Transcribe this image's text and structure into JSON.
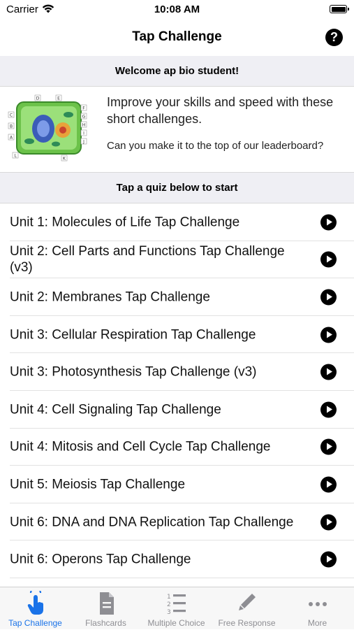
{
  "status_bar": {
    "carrier": "Carrier",
    "time": "10:08 AM"
  },
  "nav": {
    "title": "Tap Challenge",
    "help_symbol": "?"
  },
  "welcome": "Welcome ap bio student!",
  "intro": {
    "main": "Improve your skills and speed with these short challenges.",
    "sub": "Can you make it to the top of our leaderboard?",
    "image_labels": [
      "D",
      "E",
      "F",
      "G",
      "H",
      "I",
      "J",
      "K",
      "L",
      "A",
      "B",
      "C"
    ]
  },
  "section_header": "Tap a quiz below to start",
  "quizzes": [
    "Unit 1: Molecules of Life Tap Challenge",
    "Unit 2: Cell Parts and Functions Tap Challenge (v3)",
    "Unit 2: Membranes Tap Challenge",
    "Unit 3: Cellular Respiration Tap Challenge",
    "Unit 3: Photosynthesis Tap Challenge (v3)",
    "Unit 4: Cell Signaling Tap Challenge",
    "Unit 4: Mitosis and Cell Cycle Tap Challenge",
    "Unit 5: Meiosis Tap Challenge",
    "Unit 6: DNA and DNA Replication Tap Challenge",
    "Unit 6: Operons Tap Challenge"
  ],
  "tabs": [
    {
      "label": "Tap Challenge",
      "icon": "tap-hand-icon",
      "active": true
    },
    {
      "label": "Flashcards",
      "icon": "flashcard-icon",
      "active": false
    },
    {
      "label": "Multiple Choice",
      "icon": "numbered-list-icon",
      "active": false
    },
    {
      "label": "Free Response",
      "icon": "pencil-icon",
      "active": false
    },
    {
      "label": "More",
      "icon": "more-dots-icon",
      "active": false
    }
  ],
  "colors": {
    "accent": "#1a73e8",
    "inactive": "#8e8e93",
    "section_bg": "#efeff4"
  }
}
